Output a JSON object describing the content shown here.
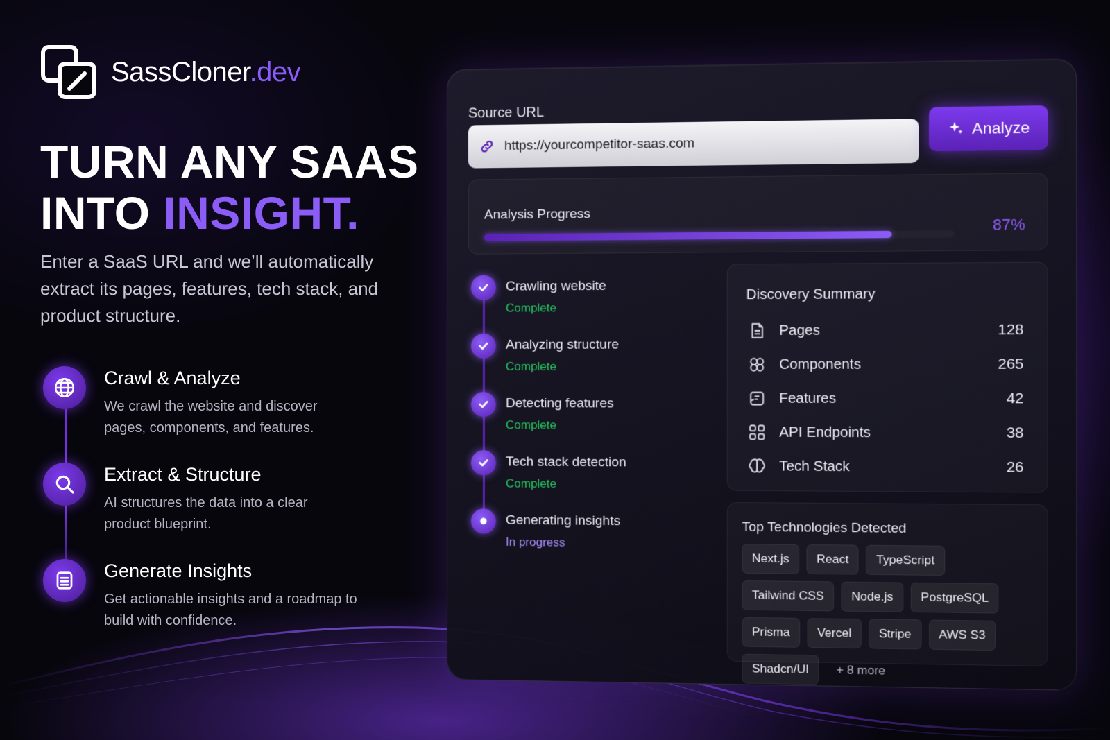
{
  "brand": {
    "name": "SassCloner",
    "tld": ".dev"
  },
  "hero": {
    "line1": "TURN ANY SAAS",
    "line2_prefix": "INTO ",
    "line2_accent": "INSIGHT.",
    "lead": "Enter a SaaS URL and we’ll automatically extract its pages, features, tech stack, and product structure."
  },
  "features": [
    {
      "icon": "globe-icon",
      "title": "Crawl & Analyze",
      "desc": "We crawl the website and discover pages, components, and features."
    },
    {
      "icon": "search-icon",
      "title": "Extract & Structure",
      "desc": "AI structures the data into a clear product blueprint."
    },
    {
      "icon": "document-icon",
      "title": "Generate Insights",
      "desc": "Get actionable insights and a roadmap to build with confidence."
    }
  ],
  "panel": {
    "source_label": "Source URL",
    "url_value": "https://yourcompetitor-saas.com",
    "analyze_label": "Analyze",
    "progress": {
      "label": "Analysis Progress",
      "percent_text": "87%",
      "value": 87
    },
    "steps": [
      {
        "title": "Crawling website",
        "status": "Complete",
        "state": "done"
      },
      {
        "title": "Analyzing structure",
        "status": "Complete",
        "state": "done"
      },
      {
        "title": "Detecting features",
        "status": "Complete",
        "state": "done"
      },
      {
        "title": "Tech stack detection",
        "status": "Complete",
        "state": "done"
      },
      {
        "title": "Generating insights",
        "status": "In progress",
        "state": "active"
      }
    ],
    "discovery": {
      "title": "Discovery Summary",
      "rows": [
        {
          "icon": "page-icon",
          "label": "Pages",
          "value": "128"
        },
        {
          "icon": "components-icon",
          "label": "Components",
          "value": "265"
        },
        {
          "icon": "features-icon",
          "label": "Features",
          "value": "42"
        },
        {
          "icon": "api-icon",
          "label": "API Endpoints",
          "value": "38"
        },
        {
          "icon": "brain-icon",
          "label": "Tech Stack",
          "value": "26"
        }
      ]
    },
    "technologies": {
      "title": "Top Technologies Detected",
      "chips": [
        "Next.js",
        "React",
        "TypeScript",
        "Tailwind CSS",
        "Node.js",
        "PostgreSQL",
        "Prisma",
        "Vercel",
        "Stripe",
        "AWS S3",
        "Shadcn/UI"
      ],
      "more": "+ 8 more"
    }
  },
  "colors": {
    "accent": "#8b5cf6",
    "accent_dark": "#5b21b6",
    "complete": "#22c55e",
    "background": "#07060d"
  }
}
